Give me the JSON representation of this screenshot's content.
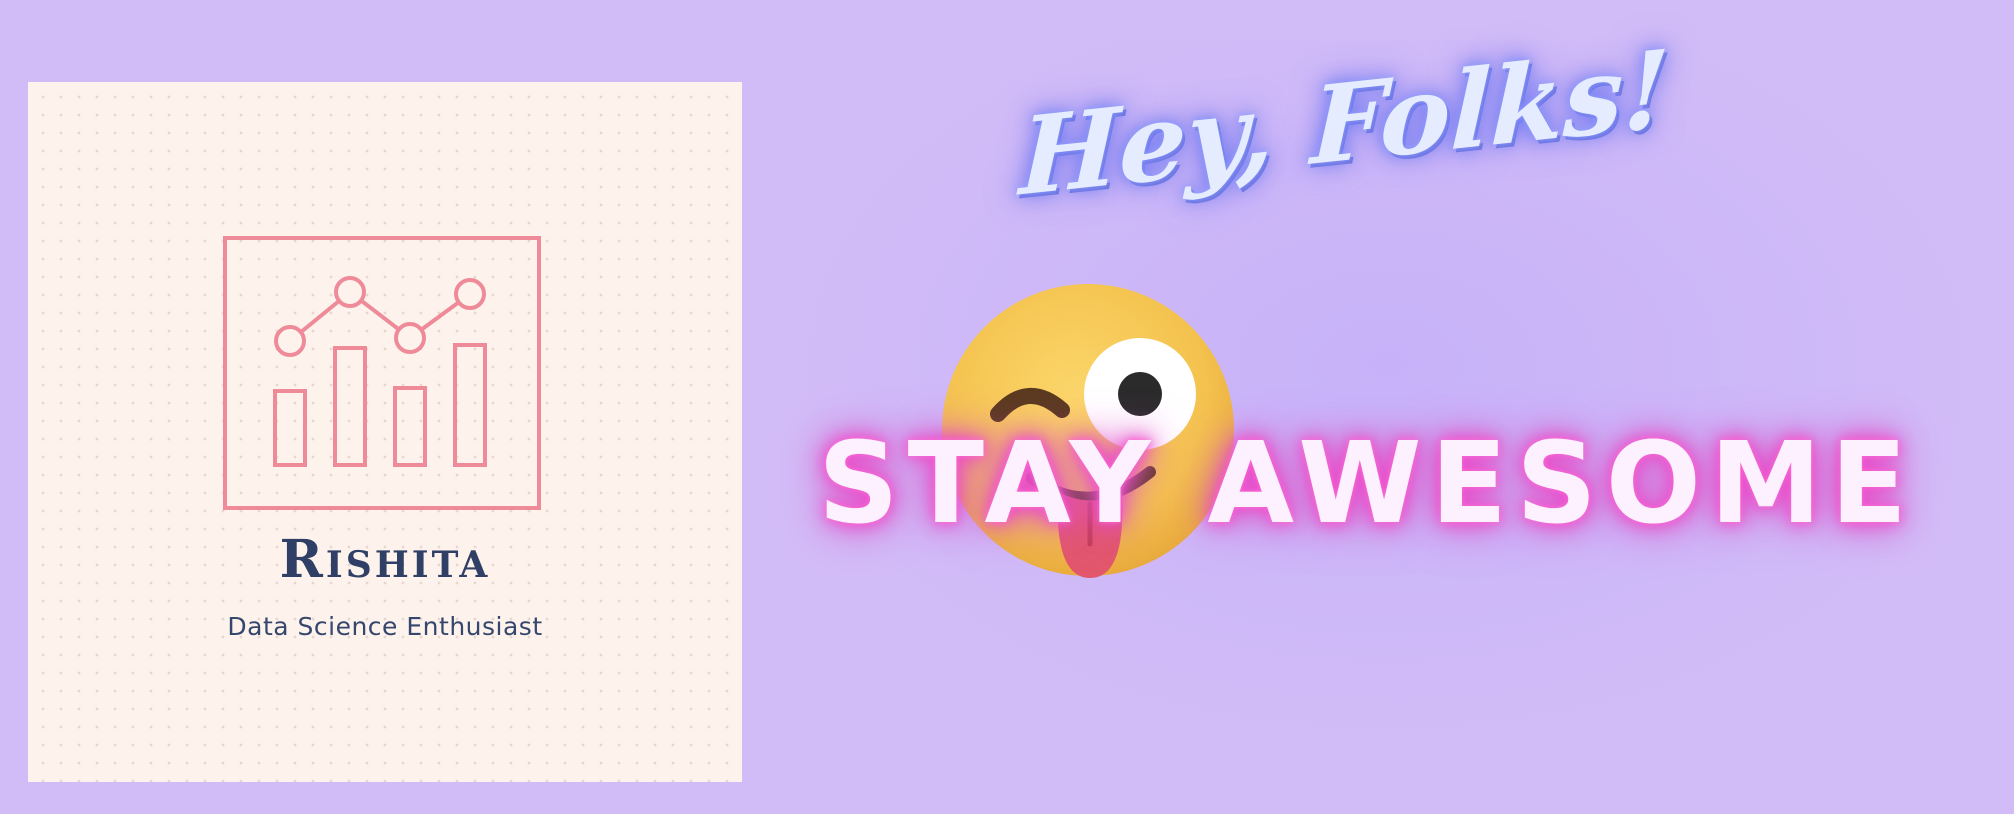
{
  "logo": {
    "name": "Rishita",
    "tagline": "Data Science Enthusiast",
    "icon": "bar-line-chart-icon",
    "accent_color": "#ef8a99",
    "text_color": "#2f3f66",
    "background_color": "#fdf3ec"
  },
  "greeting": {
    "text": "Hey, Folks!",
    "color": "#e6ecff",
    "glow_color": "#6f7cf2"
  },
  "emoji": {
    "icon": "winking-face-with-tongue-icon"
  },
  "message": {
    "text": "STAY AWESOME",
    "color": "#fdf0ff",
    "glow_color": "#f047c9"
  },
  "page": {
    "background_color": "#d2bcf7"
  }
}
